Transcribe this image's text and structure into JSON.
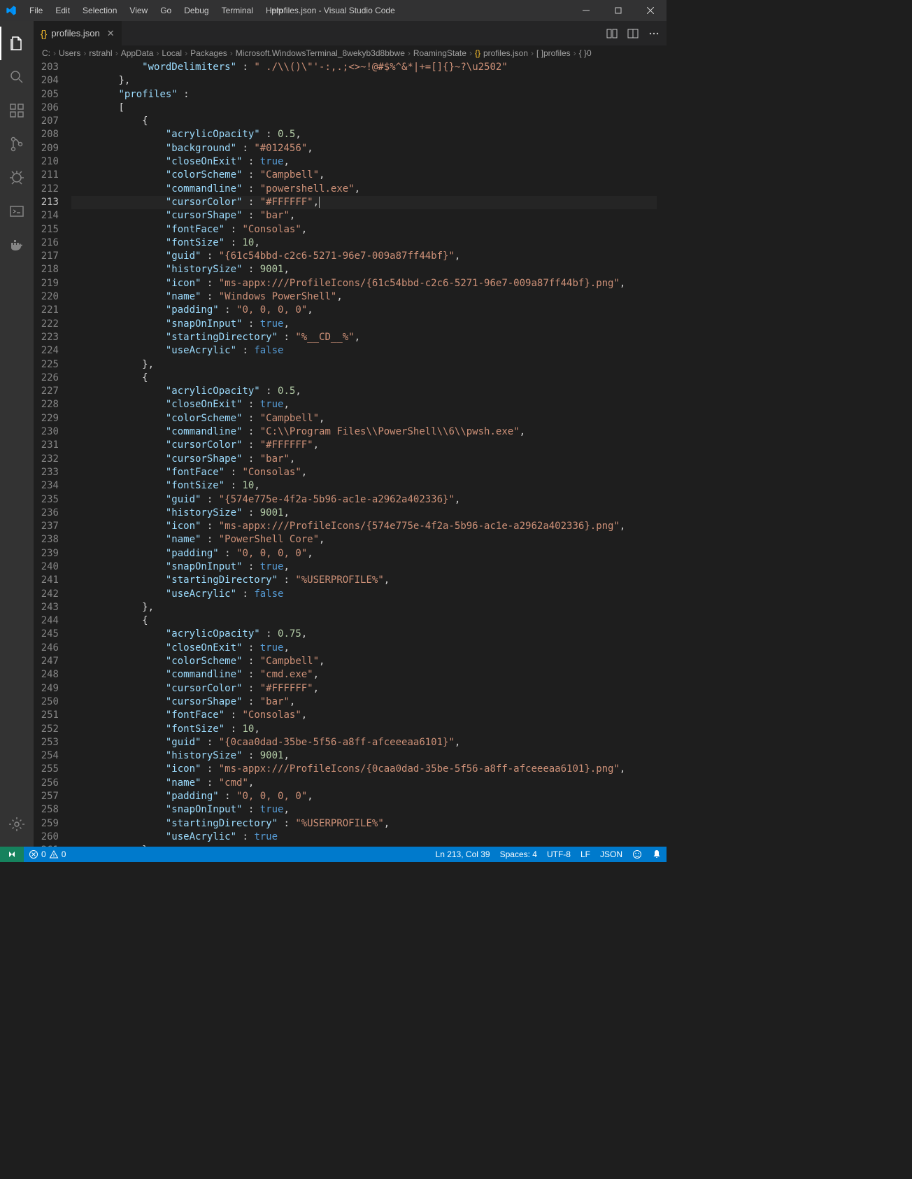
{
  "window": {
    "title": "profiles.json - Visual Studio Code"
  },
  "menu": {
    "file": "File",
    "edit": "Edit",
    "selection": "Selection",
    "view": "View",
    "go": "Go",
    "debug": "Debug",
    "terminal": "Terminal",
    "help": "Help"
  },
  "tab": {
    "filename": "profiles.json"
  },
  "breadcrumb": {
    "c": "C:",
    "users": "Users",
    "rstrahl": "rstrahl",
    "appdata": "AppData",
    "local": "Local",
    "packages": "Packages",
    "msterm": "Microsoft.WindowsTerminal_8wekyb3d8bbwe",
    "roaming": "RoamingState",
    "file": "profiles.json",
    "arr": "[ ]profiles",
    "obj": "{ }0"
  },
  "lines": {
    "start": 203,
    "active": 213
  },
  "code": {
    "l203": {
      "key": "wordDelimiters",
      "val": " ./\\\\()\\\"'-:,.;<>~!@#$%^&*|+=[]{}~?\\u2502"
    },
    "l205": {
      "key": "profiles"
    },
    "p1": {
      "acrylicOpacity": 0.5,
      "background": "#012456",
      "closeOnExit": true,
      "colorScheme": "Campbell",
      "commandline": "powershell.exe",
      "cursorColor": "#FFFFFF",
      "cursorShape": "bar",
      "fontFace": "Consolas",
      "fontSize": 10,
      "guid": "{61c54bbd-c2c6-5271-96e7-009a87ff44bf}",
      "historySize": 9001,
      "icon": "ms-appx:///ProfileIcons/{61c54bbd-c2c6-5271-96e7-009a87ff44bf}.png",
      "name": "Windows PowerShell",
      "padding": "0, 0, 0, 0",
      "snapOnInput": true,
      "startingDirectory": "%__CD__%",
      "useAcrylic": false
    },
    "p2": {
      "acrylicOpacity": 0.5,
      "closeOnExit": true,
      "colorScheme": "Campbell",
      "commandline": "C:\\\\Program Files\\\\PowerShell\\\\6\\\\pwsh.exe",
      "cursorColor": "#FFFFFF",
      "cursorShape": "bar",
      "fontFace": "Consolas",
      "fontSize": 10,
      "guid": "{574e775e-4f2a-5b96-ac1e-a2962a402336}",
      "historySize": 9001,
      "icon": "ms-appx:///ProfileIcons/{574e775e-4f2a-5b96-ac1e-a2962a402336}.png",
      "name": "PowerShell Core",
      "padding": "0, 0, 0, 0",
      "snapOnInput": true,
      "startingDirectory": "%USERPROFILE%",
      "useAcrylic": false
    },
    "p3": {
      "acrylicOpacity": 0.75,
      "closeOnExit": true,
      "colorScheme": "Campbell",
      "commandline": "cmd.exe",
      "cursorColor": "#FFFFFF",
      "cursorShape": "bar",
      "fontFace": "Consolas",
      "fontSize": 10,
      "guid": "{0caa0dad-35be-5f56-a8ff-afceeeaa6101}",
      "historySize": 9001,
      "icon": "ms-appx:///ProfileIcons/{0caa0dad-35be-5f56-a8ff-afceeeaa6101}.png",
      "name": "cmd",
      "padding": "0, 0, 0, 0",
      "snapOnInput": true,
      "startingDirectory": "%USERPROFILE%",
      "useAcrylic": true
    }
  },
  "status": {
    "errors": "0",
    "warnings": "0",
    "lncol": "Ln 213, Col 39",
    "spaces": "Spaces: 4",
    "encoding": "UTF-8",
    "eol": "LF",
    "lang": "JSON"
  }
}
